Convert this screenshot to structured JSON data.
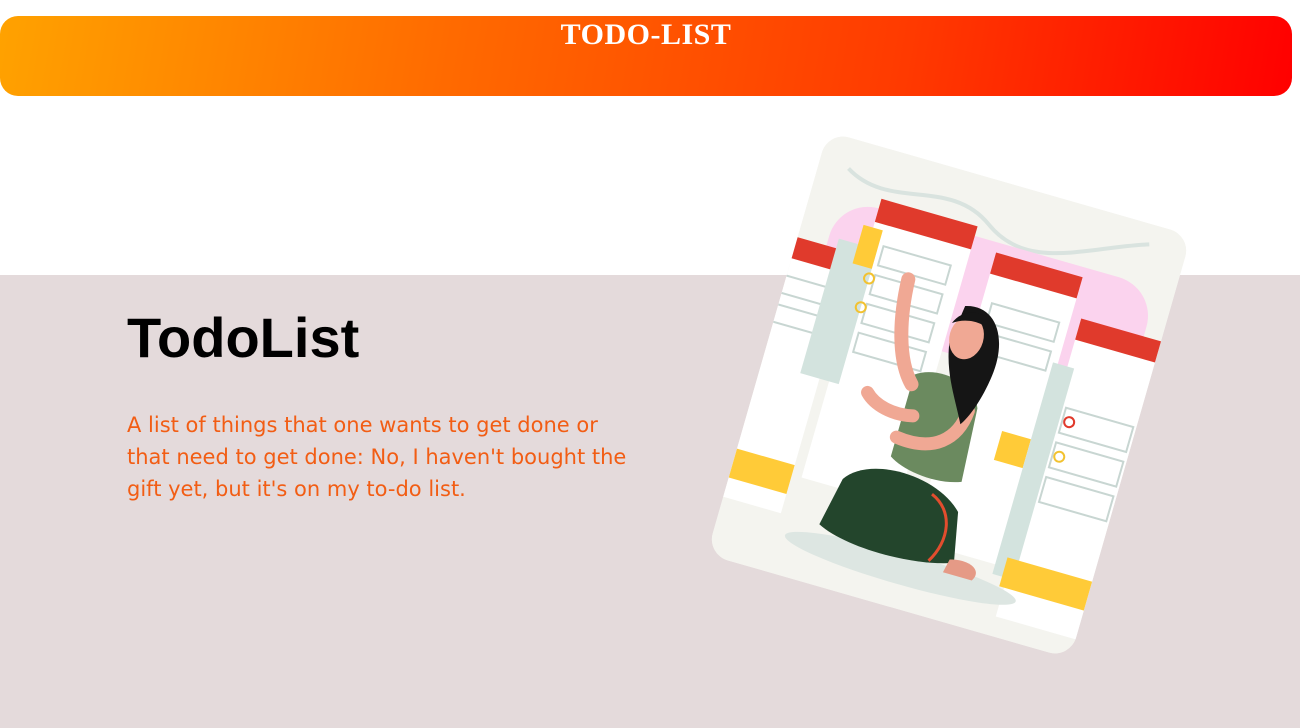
{
  "header": {
    "title": "TODO-LIST"
  },
  "hero": {
    "title": "TodoList",
    "description": "A list of things that one wants to get done or that need to get done: No, I haven't bought the gift yet, but it's on my to-do list."
  },
  "colors": {
    "header_gradient_start": "#ffa200",
    "header_gradient_end": "#ff0000",
    "hero_background": "#e4dadb",
    "description_text": "#f25d14",
    "title_text": "#000000"
  },
  "illustration": {
    "subject": "woman-kneeling-with-todo-list-cards"
  }
}
